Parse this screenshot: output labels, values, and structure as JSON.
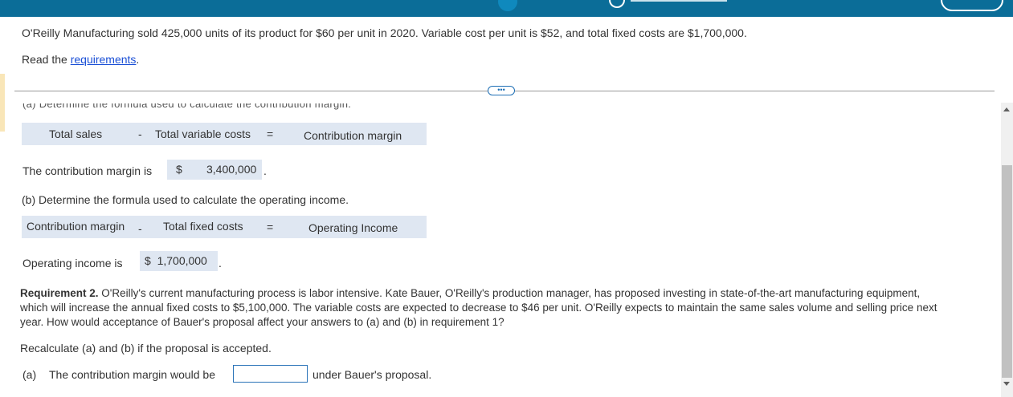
{
  "intro": "O'Reilly Manufacturing sold 425,000 units of its product for $60 per unit in 2020. Variable cost per unit is $52, and total fixed costs are $1,700,000.",
  "read_prefix": "Read the ",
  "requirements_link": "requirements",
  "read_suffix": ".",
  "more_button": "•••",
  "cutoff_text": "(a) Determine the formula used to calculate the contribution margin.",
  "formula_a": {
    "term1": "Total sales",
    "op1": "-",
    "term2": "Total variable costs",
    "op2": "=",
    "result": "Contribution margin"
  },
  "cm_text": "The contribution margin is",
  "cm_currency": "$",
  "cm_value": "3,400,000",
  "period": ".",
  "part_b_heading": "(b) Determine the formula used to calculate the operating income.",
  "formula_b": {
    "term1": "Contribution margin",
    "op1": "-",
    "term2": "Total fixed costs",
    "op2": "=",
    "result": "Operating Income"
  },
  "oi_text": "Operating income is",
  "oi_value": "$  1,700,000",
  "req2_bold": "Requirement 2.",
  "req2_line1": " O'Reilly's current manufacturing process is labor intensive. Kate Bauer, O'Reilly's production manager, has proposed investing in state-of-the-art manufacturing equipment,",
  "req2_line2": "which will increase the annual fixed costs to $5,100,000. The variable costs are expected to decrease to $46 per unit. O'Reilly expects to maintain the same sales volume and selling price next",
  "req2_line3": "year. How would acceptance of Bauer's proposal affect your answers to (a) and (b) in requirement 1?",
  "recalc": "Recalculate (a) and (b) if the proposal is accepted.",
  "part_a_prefix": "(a)",
  "part_a_text": "The contribution margin would be",
  "part_a_input_value": "",
  "part_a_suffix": "under Bauer's proposal."
}
